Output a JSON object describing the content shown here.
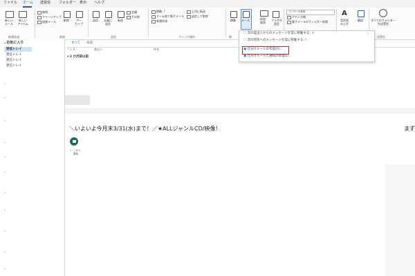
{
  "tabs": [
    "ファイル",
    "ホーム",
    "送受信",
    "フォルダー",
    "表示",
    "ヘルプ"
  ],
  "active_tab": "ホーム",
  "ribbon": {
    "new_mail": "新しい\nメール",
    "new_item": "新しい\nアイテム",
    "new_group_label": "新規作成",
    "ignore": "無視",
    "cleanup": "クリーンアップ",
    "junk": "迷惑メール",
    "delete": "削除",
    "archive": "アー\nカイブ",
    "delete_group_label": "削除",
    "reply": "返信",
    "reply_all": "全員に\n返信",
    "forward": "転送",
    "meeting": "会議",
    "more": "その他",
    "respond_group_label": "返信",
    "quicksteps": [
      "移動: ?",
      "チーム宛て電子メール",
      "新規作成"
    ],
    "quicksteps_right": [
      "上司に転送",
      "返信して削除"
    ],
    "quicksteps_group_label": "クイック操作",
    "move": "移動",
    "rules": "ルール",
    "move_group_label": "移",
    "unread_read": "未読/\n既読",
    "categorize": "分類",
    "followup": "フラグの\n設定",
    "search_people": "ユーザーの検索",
    "address_book": "アドレス帳",
    "filter_email": "電子メールのフィルター処理",
    "read_aloud": "音声読\nみ上げ",
    "translate": "翻訳",
    "send_receive_all": "すべてのフォルダー\nを送受信",
    "send_receive_group_label": "送受信"
  },
  "rules_menu": {
    "items": [
      "次の差出人からのメッセージを常に移動する: ト",
      "次の宛先へのメッセージを常に移動する: I",
      "仕分けルールの作成(R)...",
      "仕分けルールと通知の管理(L)..."
    ],
    "highlighted_index": 2
  },
  "folders": {
    "favorites_label": "お気に入り",
    "items": [
      "受信トレイ",
      "受信トレイ",
      "受信トレイ",
      "受信トレイ"
    ]
  },
  "list": {
    "filter_all": "すべて",
    "filter_unread": "未読",
    "col_from": "差出人",
    "col_subject": "件名",
    "group_header": "2 か月前以前"
  },
  "reading": {
    "subject": "＼いよいよ今月末3/31(水)まで！／★ALLジャンルCD/映像！",
    "subject_right": "まずに",
    "info_text": "このメ",
    "info_text2": "基者"
  },
  "colors": {
    "accent": "#1b5fb4",
    "highlight_border": "#c2262e",
    "avatar": "#1f6b5a"
  }
}
